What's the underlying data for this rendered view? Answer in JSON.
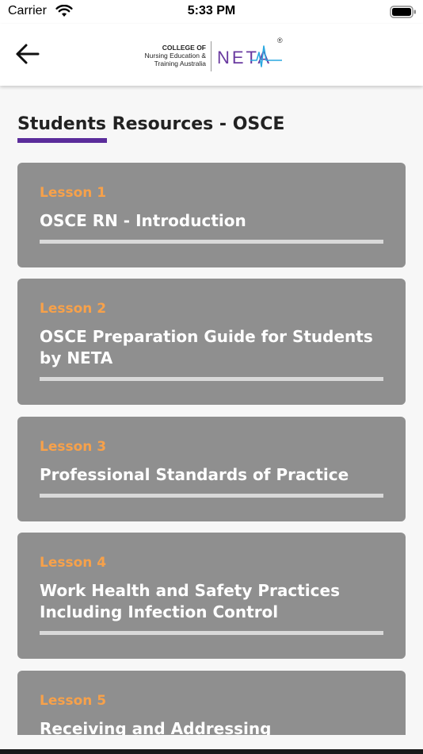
{
  "status_bar": {
    "carrier": "Carrier",
    "time": "5:33 PM"
  },
  "nav": {
    "logo_college_line1": "COLLEGE OF",
    "logo_college_line2": "Nursing Education &",
    "logo_college_line3": "Training Australia",
    "logo_brand": "NETA",
    "logo_registered": "®"
  },
  "page": {
    "title": "Students Resources - OSCE",
    "accent_color": "#5b2d9b",
    "card_color": "#8f8f8f",
    "lesson_number_color": "#f7a14a"
  },
  "lessons": [
    {
      "number": "Lesson 1",
      "title": "OSCE RN - Introduction"
    },
    {
      "number": "Lesson 2",
      "title": "OSCE Preparation Guide for Students by NETA"
    },
    {
      "number": "Lesson 3",
      "title": "Professional Standards of Practice"
    },
    {
      "number": "Lesson 4",
      "title": "Work Health and Safety Practices Including Infection Control"
    },
    {
      "number": "Lesson 5",
      "title": "Receiving and Addressing"
    }
  ]
}
